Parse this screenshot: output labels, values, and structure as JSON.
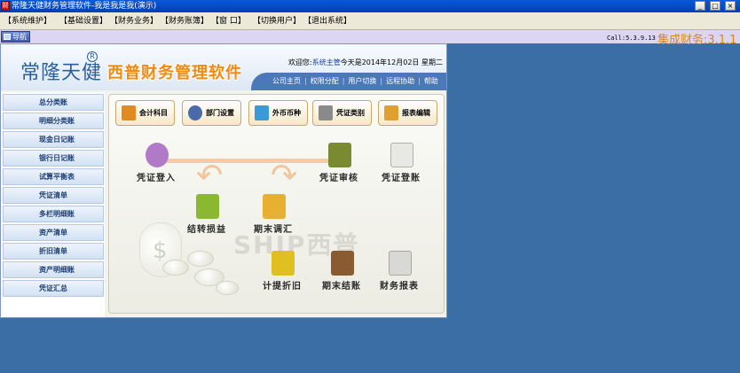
{
  "window": {
    "title": "常隆天健财务管理软件-我是我是我(演示)",
    "minimize": "_",
    "maximize": "□",
    "close": "×"
  },
  "menu": [
    "【系统维护】",
    "【基础设置】",
    "【财务业务】",
    "【财务账簿】",
    "【窗 口】",
    "【切换用户】",
    "【退出系统】"
  ],
  "nav": {
    "label": "导航"
  },
  "version": "Call:5.3.9.13",
  "brand_version": "集成财务:3.1.1",
  "header": {
    "logo": "常隆天健",
    "registered": "R",
    "product": "西普财务管理软件",
    "welcome_prefix": "欢迎您:",
    "welcome_user": "系统主管",
    "welcome_suffix": "今天是2014年12月02日  星期二",
    "links": [
      "公司主页",
      "权限分配",
      "用户切换",
      "远程协助",
      "帮助"
    ],
    "separator": "|"
  },
  "sidebar": [
    "总分类账",
    "明细分类账",
    "现金日记账",
    "银行日记账",
    "试算平衡表",
    "凭证清单",
    "多栏明细账",
    "资产清单",
    "折旧清单",
    "资产明细账",
    "凭证汇总"
  ],
  "toolbar": [
    {
      "label": "会计科目",
      "icon": "ledger-icon",
      "color": "#e08a20"
    },
    {
      "label": "部门设置",
      "icon": "department-icon",
      "color": "#4a6aa8"
    },
    {
      "label": "外币币种",
      "icon": "currency-icon",
      "color": "#3a9ad8"
    },
    {
      "label": "凭证类别",
      "icon": "voucher-type-icon",
      "color": "#8a8a8a"
    },
    {
      "label": "报表编辑",
      "icon": "report-edit-icon",
      "color": "#e0a030"
    }
  ],
  "flow": {
    "voucher_entry": "凭证登入",
    "voucher_review": "凭证审核",
    "voucher_post": "凭证登账",
    "transfer_pl": "结转损益",
    "period_end_adjust": "期末调汇",
    "depreciation": "计提折旧",
    "period_close": "期末结账",
    "financial_report": "财务报表"
  },
  "watermark": "SHIP西普",
  "colors": {
    "desktop": "#3a6ea5",
    "accent_orange": "#f08a10",
    "header_blue": "#4a78b8"
  }
}
